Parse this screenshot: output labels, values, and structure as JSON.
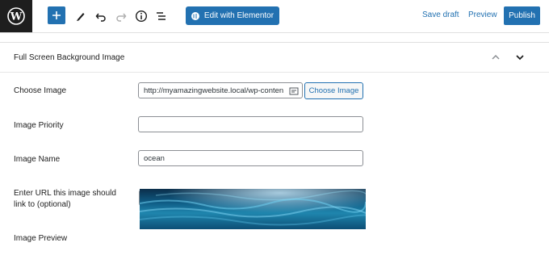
{
  "toolbar": {
    "logo_icon": "wordpress-logo",
    "icons": [
      "plus-icon",
      "pen-icon",
      "undo-icon",
      "redo-icon",
      "info-icon",
      "list-view-icon"
    ],
    "elementor_label": "Edit with Elementor",
    "save_draft_label": "Save draft",
    "preview_label": "Preview",
    "publish_label": "Publish"
  },
  "metabox": {
    "title": "Full Screen Background Image",
    "fields": {
      "choose_image": {
        "label": "Choose Image",
        "value": "http://myamazingwebsite.local/wp-conten",
        "button_label": "Choose Image"
      },
      "image_priority": {
        "label": "Image Priority",
        "value": ""
      },
      "image_name": {
        "label": "Image Name",
        "value": "ocean"
      },
      "link_url": {
        "label": "Enter URL this image should link to (optional)",
        "value": ""
      },
      "image_preview": {
        "label": "Image Preview"
      }
    }
  },
  "colors": {
    "accent": "#2271b1",
    "dark": "#1e1e1e",
    "border": "#8c8f94"
  }
}
